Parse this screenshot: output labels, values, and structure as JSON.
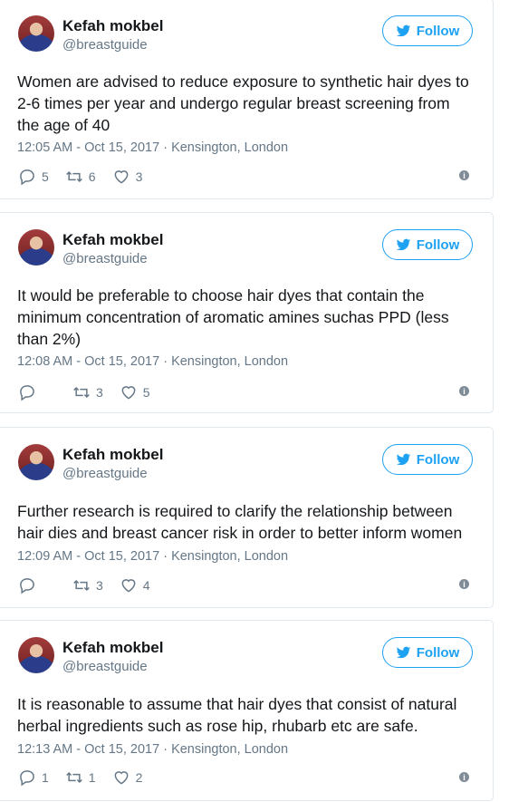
{
  "tweets": [
    {
      "name": "Kefah mokbel",
      "handle": "@breastguide",
      "follow_label": "Follow",
      "text": "Women are advised to reduce exposure to synthetic hair dyes to 2-6 times per year and undergo regular breast screening from the age of 40",
      "meta": "12:05 AM - Oct 15, 2017 · Kensington, London",
      "replies": "5",
      "retweets": "6",
      "likes": "3"
    },
    {
      "name": "Kefah mokbel",
      "handle": "@breastguide",
      "follow_label": "Follow",
      "text": "It would be preferable to choose hair dyes that contain the minimum concentration of aromatic amines suchas PPD (less than 2%)",
      "meta": "12:08 AM - Oct 15, 2017 · Kensington, London",
      "replies": "",
      "retweets": "3",
      "likes": "5"
    },
    {
      "name": "Kefah mokbel",
      "handle": "@breastguide",
      "follow_label": "Follow",
      "text": "Further research is required to clarify the relationship between hair dies and breast cancer risk in order to better inform women",
      "meta": "12:09 AM - Oct 15, 2017 · Kensington, London",
      "replies": "",
      "retweets": "3",
      "likes": "4"
    },
    {
      "name": "Kefah mokbel",
      "handle": "@breastguide",
      "follow_label": "Follow",
      "text": "It is reasonable to assume that hair dyes that consist of natural herbal ingredients such as rose hip, rhubarb etc are safe.",
      "meta": "12:13 AM - Oct 15, 2017 · Kensington, London",
      "replies": "1",
      "retweets": "1",
      "likes": "2"
    }
  ]
}
